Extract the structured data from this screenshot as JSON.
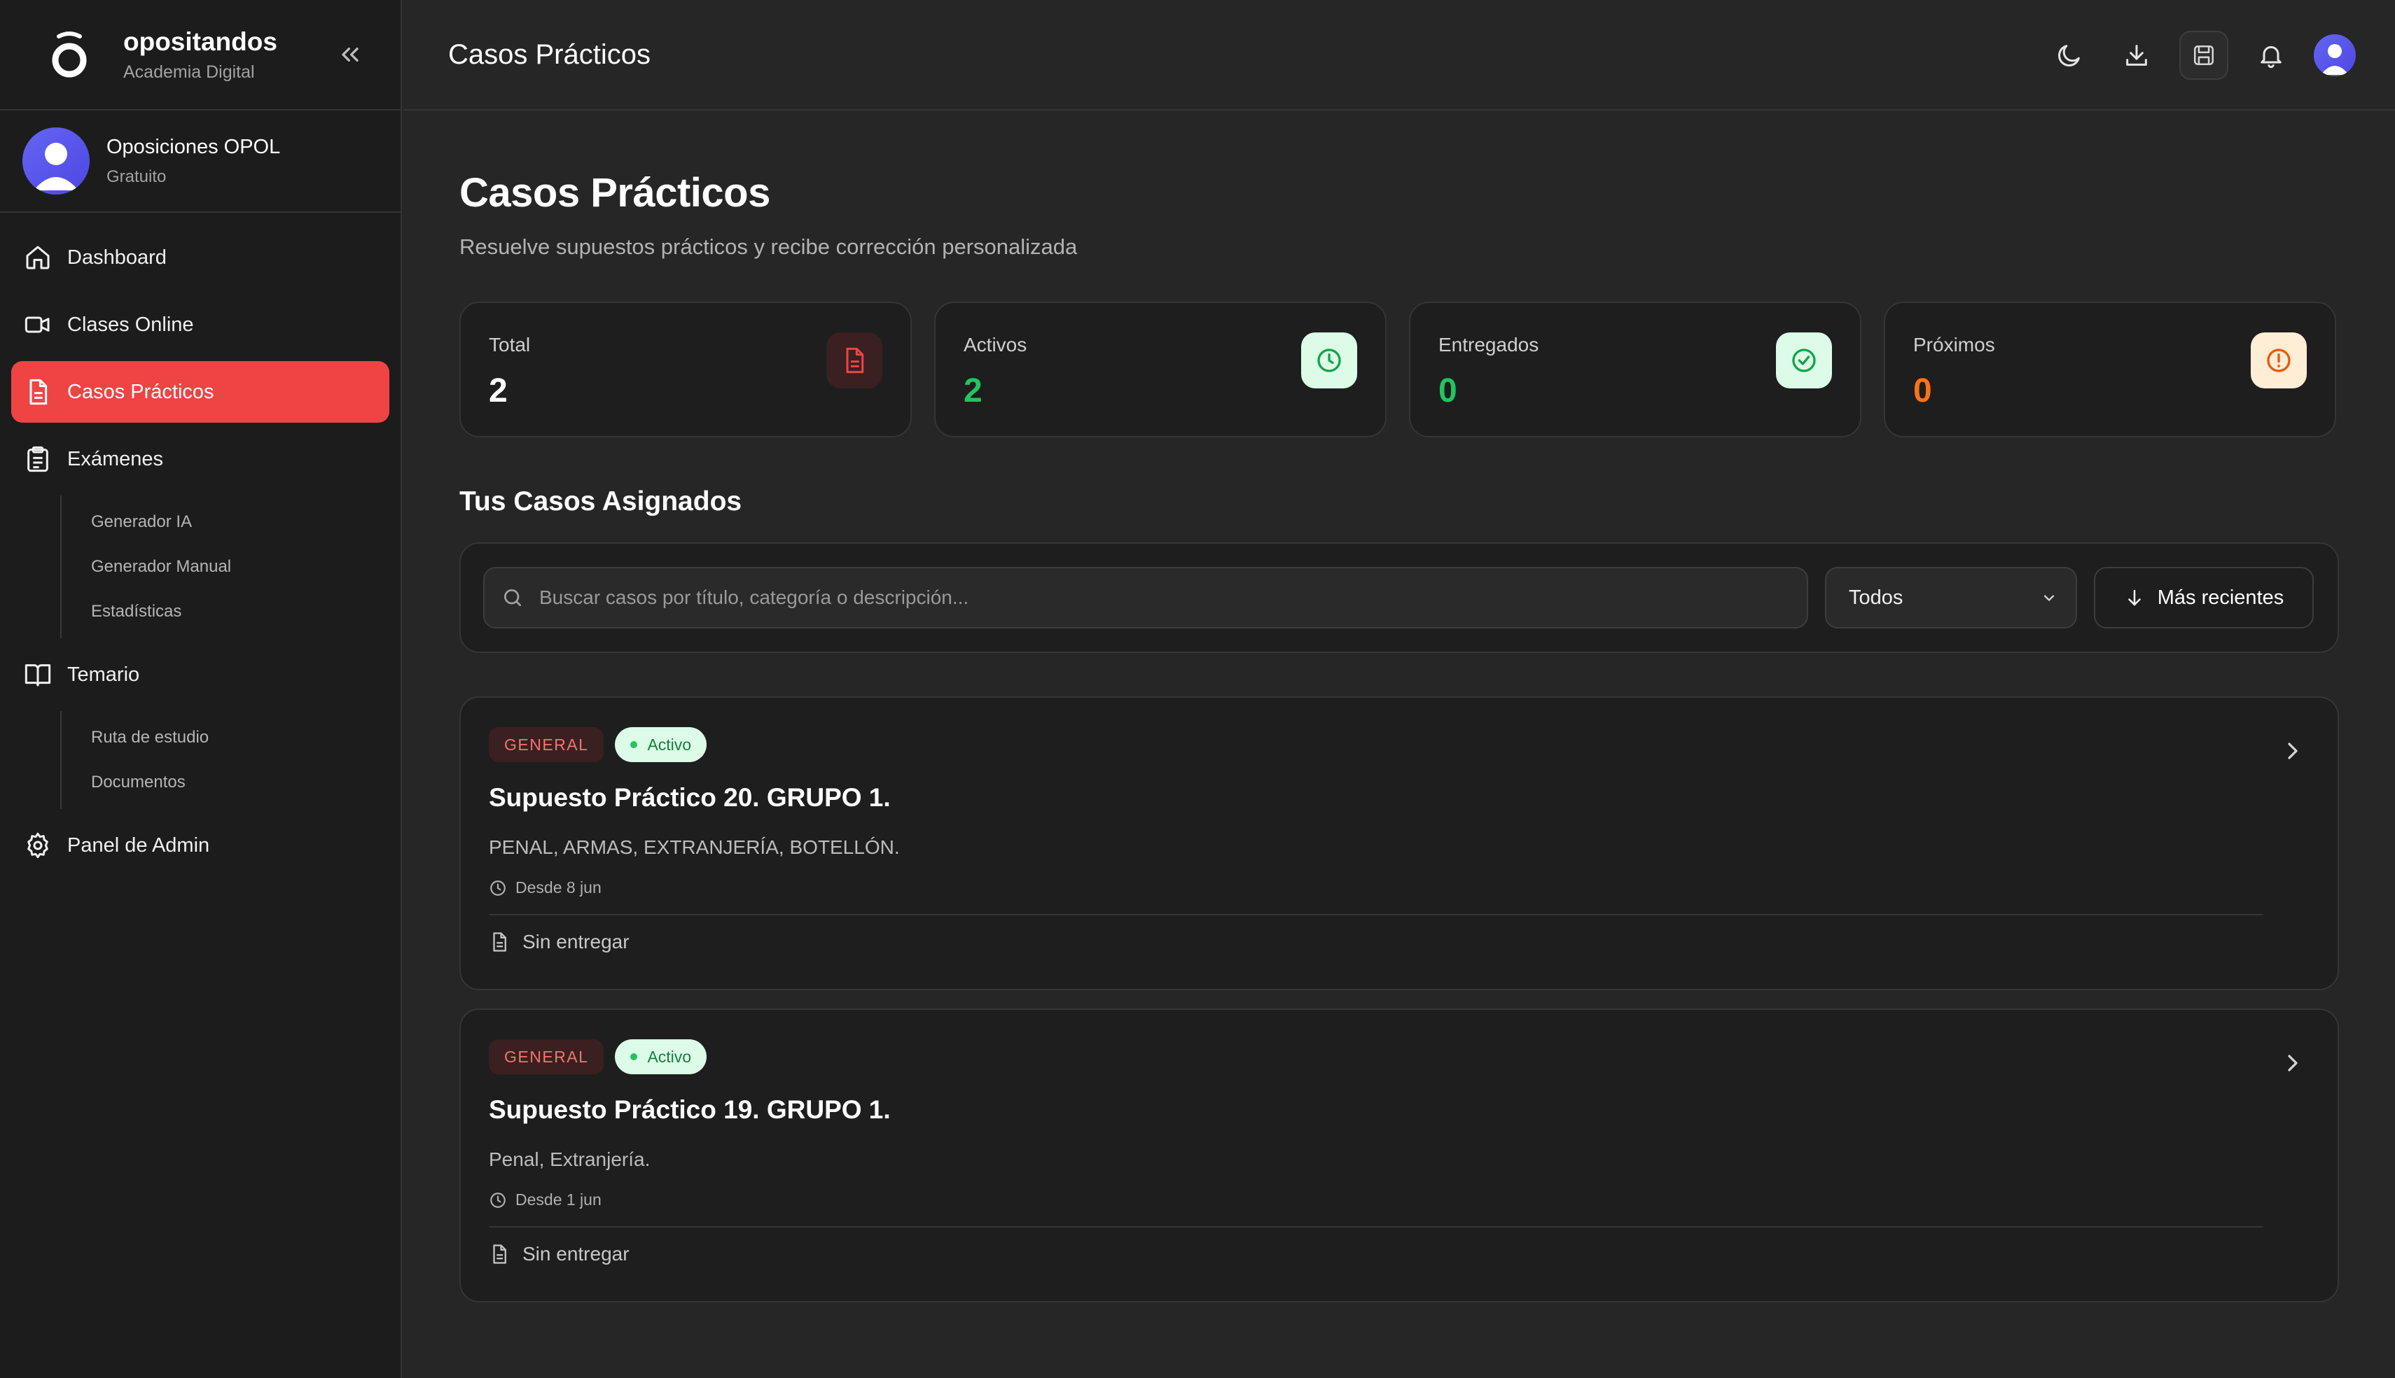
{
  "brand": {
    "name": "opositandos",
    "subtitle": "Academia Digital"
  },
  "user": {
    "name": "Oposiciones OPOL",
    "plan": "Gratuito"
  },
  "sidebar": {
    "items": [
      {
        "label": "Dashboard",
        "icon": "home-icon"
      },
      {
        "label": "Clases Online",
        "icon": "video-icon"
      },
      {
        "label": "Casos Prácticos",
        "icon": "document-icon",
        "active": true
      },
      {
        "label": "Exámenes",
        "icon": "clipboard-icon",
        "children": [
          "Generador IA",
          "Generador Manual",
          "Estadísticas"
        ]
      },
      {
        "label": "Temario",
        "icon": "book-icon",
        "children": [
          "Ruta de estudio",
          "Documentos"
        ]
      },
      {
        "label": "Panel de Admin",
        "icon": "gear-icon"
      }
    ]
  },
  "header": {
    "title": "Casos Prácticos",
    "icons": [
      "moon-icon",
      "download-icon",
      "save-icon",
      "bell-icon",
      "avatar"
    ]
  },
  "page": {
    "title": "Casos Prácticos",
    "subtitle": "Resuelve supuestos prácticos y recibe corrección personalizada"
  },
  "stats": [
    {
      "label": "Total",
      "value": "2",
      "color": "#ffffff",
      "icon": "document-icon"
    },
    {
      "label": "Activos",
      "value": "2",
      "color": "#22c55e",
      "icon": "clock-icon"
    },
    {
      "label": "Entregados",
      "value": "0",
      "color": "#22c55e",
      "icon": "check-circle-icon"
    },
    {
      "label": "Próximos",
      "value": "0",
      "color": "#f97316",
      "icon": "alert-circle-icon"
    }
  ],
  "section": {
    "title": "Tus Casos Asignados"
  },
  "filters": {
    "search_placeholder": "Buscar casos por título, categoría o descripción...",
    "select_value": "Todos",
    "sort_label": "Más recientes"
  },
  "cases": [
    {
      "category": "GENERAL",
      "status": "Activo",
      "title": "Supuesto Práctico 20. GRUPO 1.",
      "description": "PENAL, ARMAS, EXTRANJERÍA, BOTELLÓN.",
      "date": "Desde 8 jun",
      "delivery": "Sin entregar"
    },
    {
      "category": "GENERAL",
      "status": "Activo",
      "title": "Supuesto Práctico 19. GRUPO 1.",
      "description": "Penal, Extranjería.",
      "date": "Desde 1 jun",
      "delivery": "Sin entregar"
    }
  ],
  "colors": {
    "accent": "#ef4444",
    "background": "#262626",
    "sidebar": "#1c1c1c",
    "success": "#22c55e",
    "warning": "#f97316"
  }
}
